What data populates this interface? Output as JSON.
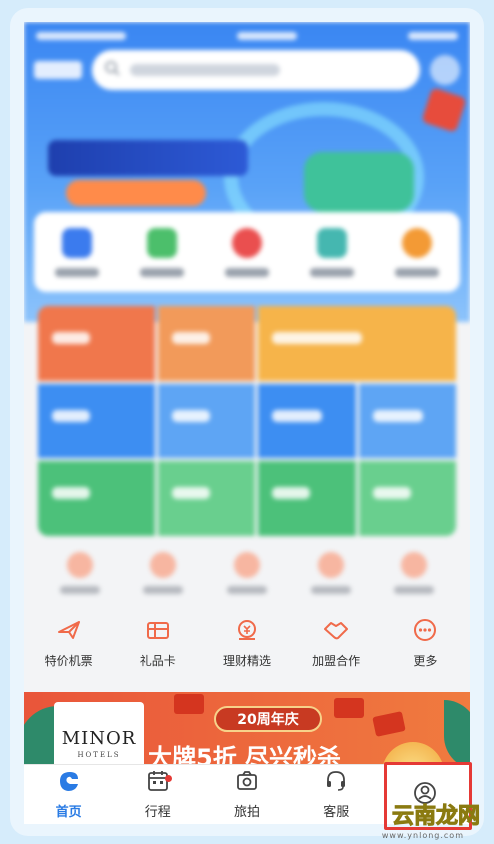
{
  "services": [
    {
      "label": "特价机票",
      "icon": "plane-icon"
    },
    {
      "label": "礼品卡",
      "icon": "gift-card-icon"
    },
    {
      "label": "理财精选",
      "icon": "finance-icon"
    },
    {
      "label": "加盟合作",
      "icon": "handshake-icon"
    },
    {
      "label": "更多",
      "icon": "more-icon"
    }
  ],
  "ad": {
    "brand": "MINOR",
    "brand_sub": "HOTELS",
    "anniversary": "20周年庆",
    "headline": "大牌5折 尽兴秒杀"
  },
  "tabs": [
    {
      "label": "首页",
      "icon": "home-icon",
      "active": true
    },
    {
      "label": "行程",
      "icon": "calendar-icon",
      "badge_dot": true
    },
    {
      "label": "旅拍",
      "icon": "camera-icon"
    },
    {
      "label": "客服",
      "icon": "headset-icon"
    },
    {
      "label": "我的",
      "icon": "profile-icon"
    }
  ],
  "watermark": {
    "text": "云南龙网",
    "sub": "www.ynlong.com"
  },
  "colors": {
    "accent": "#2a7be4",
    "highlight": "#e53935"
  }
}
